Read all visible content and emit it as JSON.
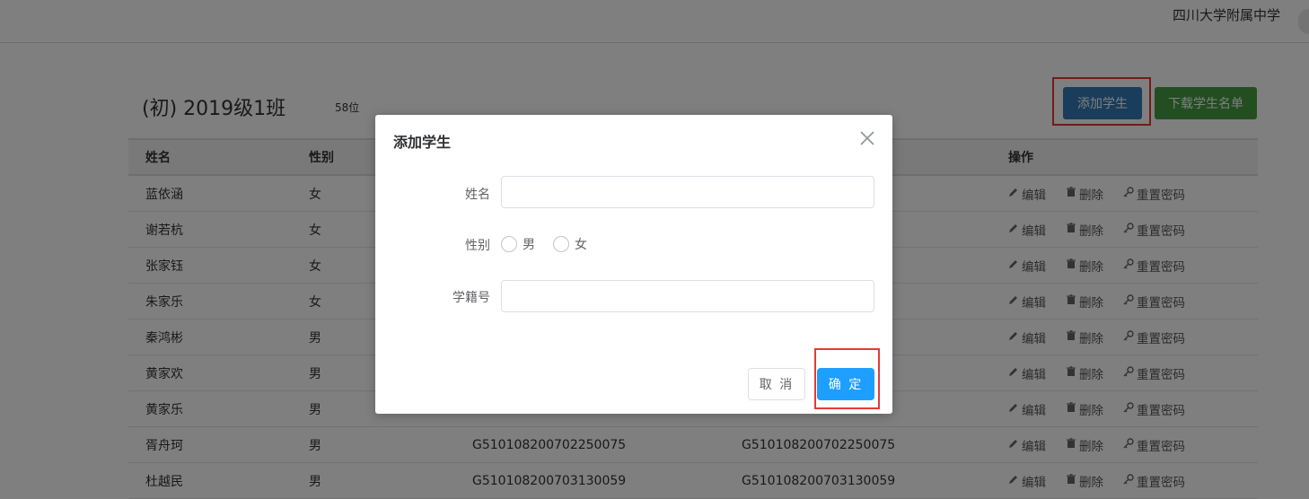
{
  "header": {
    "school": "四川大学附属中学"
  },
  "class_info": {
    "title": "(初) 2019级1班",
    "count": "58位"
  },
  "toolbar": {
    "add_label": "添加学生",
    "download_label": "下载学生名单"
  },
  "table": {
    "headers": [
      "姓名",
      "性别",
      "",
      "",
      "操作"
    ],
    "ops": {
      "edit": "编辑",
      "delete": "删除",
      "reset": "重置密码"
    },
    "rows": [
      {
        "name": "蓝依涵",
        "gender": "女",
        "id1": "",
        "id2": ""
      },
      {
        "name": "谢若杭",
        "gender": "女",
        "id1": "",
        "id2": ""
      },
      {
        "name": "张家钰",
        "gender": "女",
        "id1": "",
        "id2": ""
      },
      {
        "name": "朱家乐",
        "gender": "女",
        "id1": "",
        "id2": ""
      },
      {
        "name": "秦鸿彬",
        "gender": "男",
        "id1": "",
        "id2": ""
      },
      {
        "name": "黄家欢",
        "gender": "男",
        "id1": "",
        "id2": ""
      },
      {
        "name": "黄家乐",
        "gender": "男",
        "id1": "",
        "id2": ""
      },
      {
        "name": "胥舟珂",
        "gender": "男",
        "id1": "G510108200702250075",
        "id2": "G510108200702250075"
      },
      {
        "name": "杜越民",
        "gender": "男",
        "id1": "G510108200703130059",
        "id2": "G510108200703130059"
      }
    ]
  },
  "modal": {
    "title": "添加学生",
    "name_label": "姓名",
    "name_value": "",
    "gender_label": "性别",
    "gender_options": [
      "男",
      "女"
    ],
    "id_label": "学籍号",
    "id_value": "",
    "cancel_label": "取 消",
    "ok_label": "确 定"
  },
  "colors": {
    "primary": "#337ab7",
    "success": "#449d44",
    "confirm": "#1e9fff",
    "highlight": "#e53935"
  }
}
